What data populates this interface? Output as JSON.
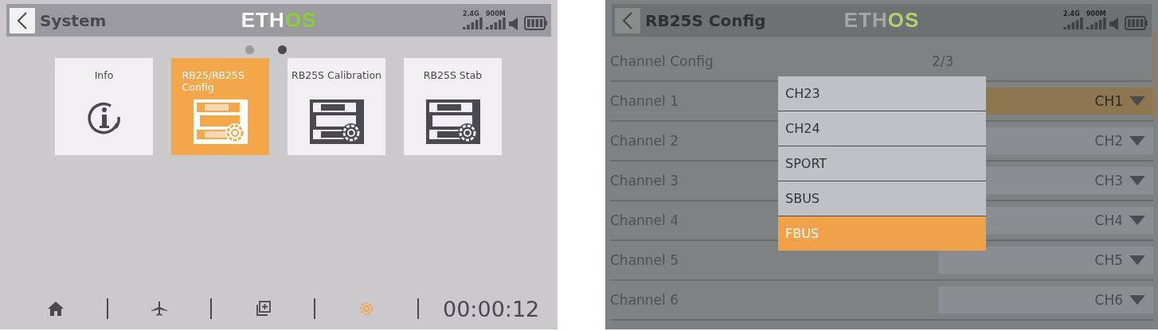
{
  "left_screen": {
    "header": {
      "title": "System",
      "logo_main": "ETH",
      "logo_accent": "OS",
      "signal_labels": [
        "2.4G",
        "900M"
      ]
    },
    "page_dots": [
      {
        "selected": false
      },
      {
        "selected": true
      }
    ],
    "tiles": [
      {
        "label": "Info",
        "kind": "info",
        "selected": false
      },
      {
        "label": "RB25/RB25S Config",
        "kind": "config",
        "selected": true
      },
      {
        "label": "RB25S Calibration",
        "kind": "config",
        "selected": false
      },
      {
        "label": "RB25S Stab",
        "kind": "config",
        "selected": false
      }
    ],
    "bottom_nav": [
      {
        "kind": "home",
        "selected": false
      },
      {
        "kind": "plane",
        "selected": false
      },
      {
        "kind": "add-screen",
        "selected": false
      },
      {
        "kind": "settings",
        "selected": true
      }
    ],
    "timer": "00:00:12"
  },
  "right_screen": {
    "header": {
      "title": "RB25S Config",
      "logo_main": "ETH",
      "logo_accent": "OS",
      "signal_labels": [
        "2.4G",
        "900M"
      ]
    },
    "rows": [
      {
        "kind": "text",
        "label": "Channel Config",
        "value": "2/3"
      },
      {
        "kind": "dropdown",
        "label": "Channel 1",
        "value": "CH1",
        "selected": true
      },
      {
        "kind": "dropdown",
        "label": "Channel 2",
        "value": "CH2",
        "selected": false
      },
      {
        "kind": "dropdown",
        "label": "Channel 3",
        "value": "CH3",
        "selected": false
      },
      {
        "kind": "dropdown",
        "label": "Channel 4",
        "value": "CH4",
        "selected": false
      },
      {
        "kind": "dropdown",
        "label": "Channel 5",
        "value": "CH5",
        "selected": false
      },
      {
        "kind": "dropdown",
        "label": "Channel 6",
        "value": "CH6",
        "selected": false
      }
    ],
    "dropdown_options": [
      {
        "label": "CH23",
        "selected": false
      },
      {
        "label": "CH24",
        "selected": false
      },
      {
        "label": "SPORT",
        "selected": false
      },
      {
        "label": "SBUS",
        "selected": false
      },
      {
        "label": "FBUS",
        "selected": true
      }
    ]
  }
}
